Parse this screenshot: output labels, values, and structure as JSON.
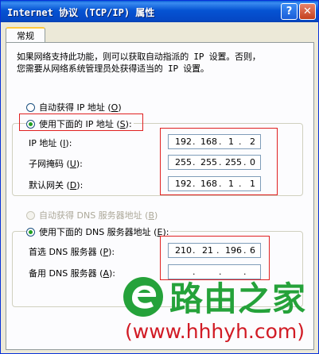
{
  "window": {
    "title": "Internet 协议 (TCP/IP) 属性",
    "help_glyph": "?",
    "close_glyph": "✕"
  },
  "tab": {
    "label": "常规"
  },
  "description": {
    "line1": "如果网络支持此功能，则可以获取自动指派的 IP 设置。否则，",
    "line2": "您需要从网络系统管理员处获得适当的 IP 设置。"
  },
  "ip_mode": {
    "auto": {
      "label": "自动获得 IP 地址",
      "key": "O",
      "selected": false
    },
    "manual": {
      "label": "使用下面的 IP 地址",
      "key": "S",
      "selected": true
    }
  },
  "ip_fields": [
    {
      "label": "IP 地址",
      "key": "I",
      "octets": [
        "192",
        "168",
        "1",
        "2"
      ]
    },
    {
      "label": "子网掩码",
      "key": "U",
      "octets": [
        "255",
        "255",
        "255",
        "0"
      ]
    },
    {
      "label": "默认网关",
      "key": "D",
      "octets": [
        "192",
        "168",
        "1",
        "1"
      ]
    }
  ],
  "dns_mode": {
    "auto": {
      "label": "自动获得 DNS 服务器地址",
      "key": "B",
      "selected": false,
      "disabled": true
    },
    "manual": {
      "label": "使用下面的 DNS 服务器地址",
      "key": "E",
      "selected": true
    }
  },
  "dns_fields": [
    {
      "label": "首选 DNS 服务器",
      "key": "P",
      "octets": [
        "210",
        "21",
        "196",
        "6"
      ]
    },
    {
      "label": "备用 DNS 服务器",
      "key": "A",
      "octets": [
        "",
        "",
        "",
        ""
      ]
    }
  ],
  "watermark": {
    "brand": "路由之家",
    "url": "(www.hhhyh.com)"
  },
  "colors": {
    "highlight_box": "#e02020",
    "title_bar": "#0553d3",
    "watermark_green": "#25a23a",
    "watermark_red": "#d11a24"
  }
}
